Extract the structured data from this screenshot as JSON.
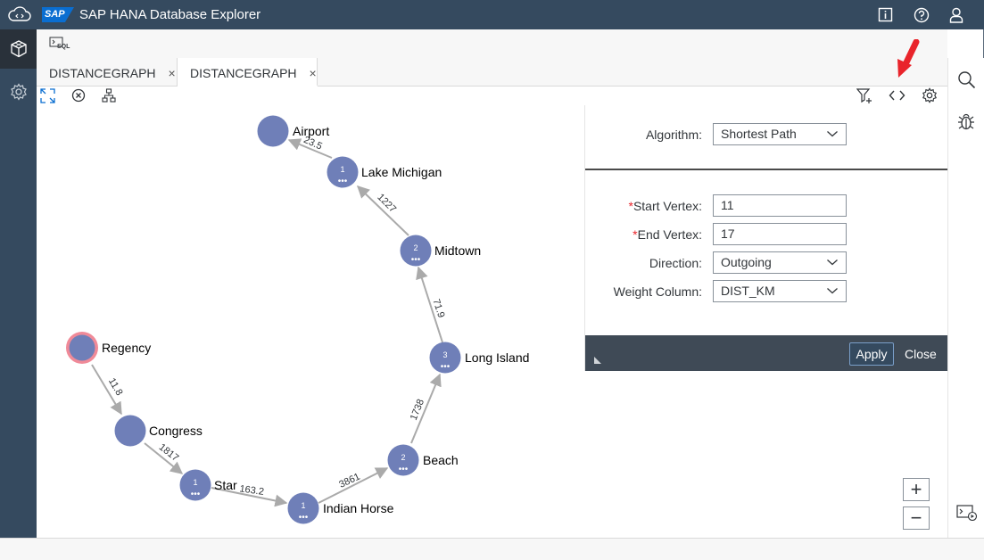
{
  "app": {
    "brand": "SAP",
    "title": "SAP HANA Database Explorer"
  },
  "toolbar": {
    "sql_label": "SQL"
  },
  "tabs": [
    {
      "label": "DISTANCEGRAPH",
      "close": "×"
    },
    {
      "label": "DISTANCEGRAPH",
      "close": "×"
    }
  ],
  "graph": {
    "nodes": [
      {
        "label": "Airport",
        "count": ""
      },
      {
        "label": "Lake Michigan",
        "count": "1"
      },
      {
        "label": "Midtown",
        "count": "2"
      },
      {
        "label": "Long Island",
        "count": "3"
      },
      {
        "label": "Beach",
        "count": "2"
      },
      {
        "label": "Indian Horse",
        "count": "1"
      },
      {
        "label": "Star",
        "count": "1"
      },
      {
        "label": "Congress",
        "count": ""
      },
      {
        "label": "Regency",
        "count": ""
      }
    ],
    "edges": [
      "23.5",
      "1227",
      "71.9",
      "1738",
      "3861",
      "163.2",
      "1817",
      "11.8"
    ]
  },
  "panel": {
    "algorithm_label": "Algorithm:",
    "algorithm_value": "Shortest Path",
    "required_mark": "*",
    "start_label": "Start Vertex:",
    "start_value": "11",
    "end_label": "End Vertex:",
    "end_value": "17",
    "direction_label": "Direction:",
    "direction_value": "Outgoing",
    "weight_label": "Weight Column:",
    "weight_value": "DIST_KM",
    "apply_label": "Apply",
    "close_label": "Close"
  },
  "zoom": {
    "in": "+",
    "out": "−"
  },
  "colors": {
    "shell": "#354a5f",
    "node": "#6f7fb8",
    "start_ring": "#f08a98",
    "arrow": "#e9242b",
    "edge": "#aaaaaa"
  },
  "icons": [
    "cloud-code-icon",
    "info-icon",
    "help-icon",
    "user-icon",
    "cube-icon",
    "settings-icon",
    "fullscreen-icon",
    "clear-icon",
    "hierarchy-icon",
    "filter-add-icon",
    "code-icon",
    "gear-icon",
    "search-icon",
    "debug-icon",
    "console-icon"
  ]
}
